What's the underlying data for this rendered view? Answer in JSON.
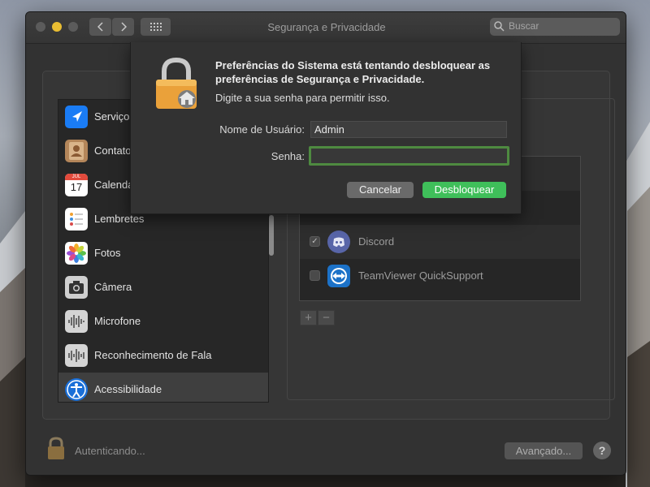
{
  "colors": {
    "accent_green": "#3fbf5a",
    "focus_ring": "#4e8a40",
    "traffic_close": "#5b5b5b",
    "traffic_min": "#e9bd32",
    "traffic_max": "#5b5b5b"
  },
  "window": {
    "title": "Segurança e Privacidade"
  },
  "toolbar": {
    "back_icon": "chevron-left-icon",
    "forward_icon": "chevron-right-icon",
    "grid_icon": "grid-icon",
    "search_placeholder": "Buscar"
  },
  "sidebar": {
    "items": [
      {
        "label": "Serviços de Localização",
        "icon": "location-arrow-icon"
      },
      {
        "label": "Contatos",
        "icon": "contacts-icon"
      },
      {
        "label": "Calendários",
        "icon": "calendar-icon",
        "month": "JUL",
        "day": "17"
      },
      {
        "label": "Lembretes",
        "icon": "reminders-icon"
      },
      {
        "label": "Fotos",
        "icon": "photos-icon"
      },
      {
        "label": "Câmera",
        "icon": "camera-icon"
      },
      {
        "label": "Microfone",
        "icon": "microphone-icon"
      },
      {
        "label": "Reconhecimento de Fala",
        "icon": "speech-icon"
      },
      {
        "label": "Acessibilidade",
        "icon": "accessibility-icon",
        "selected": true
      }
    ]
  },
  "apps": {
    "items": [
      {
        "label": "Discord",
        "checked": true,
        "icon": "discord-icon"
      },
      {
        "label": "TeamViewer QuickSupport",
        "checked": false,
        "icon": "teamviewer-icon"
      }
    ],
    "add_label": "+",
    "remove_label": "−"
  },
  "footer": {
    "status": "Autenticando...",
    "advanced_label": "Avançado...",
    "help_label": "?"
  },
  "dialog": {
    "message_bold": "Preferências do Sistema está tentando desbloquear as preferências de Segurança e Privacidade.",
    "message": "Digite a sua senha para permitir isso.",
    "username_label": "Nome de Usuário:",
    "username_value": "Admin",
    "password_label": "Senha:",
    "password_value": "",
    "cancel_label": "Cancelar",
    "unlock_label": "Desbloquear"
  }
}
